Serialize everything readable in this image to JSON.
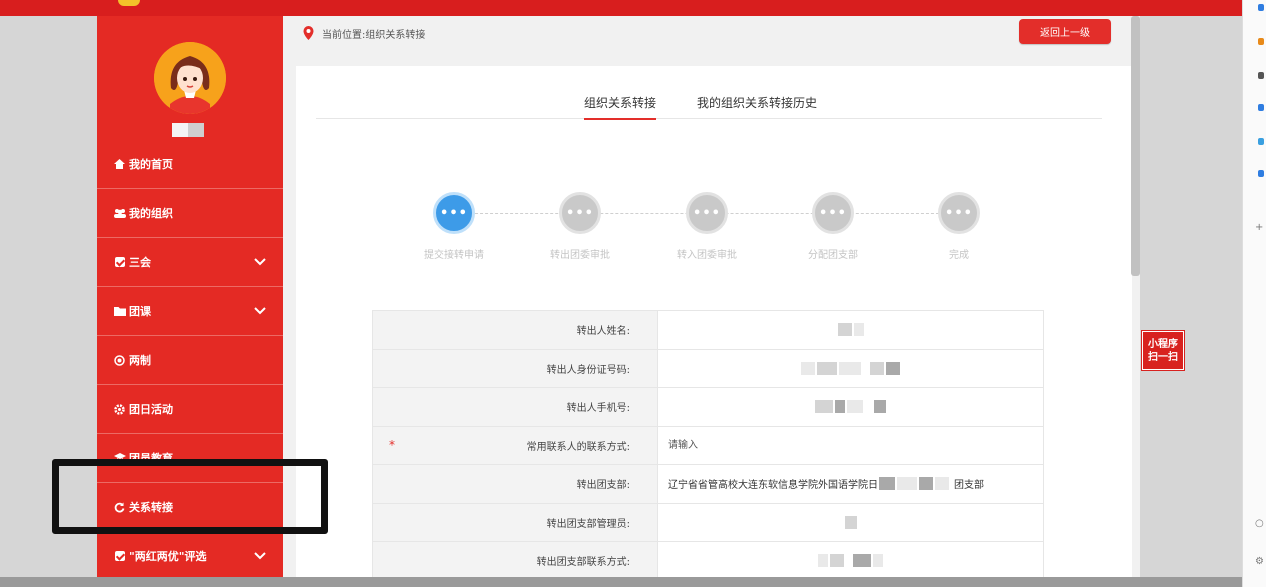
{
  "breadcrumb": {
    "text": "当前位置:组织关系转接"
  },
  "back_button": {
    "label": "返回上一级"
  },
  "tabs": [
    {
      "label": "组织关系转接",
      "active": true
    },
    {
      "label": "我的组织关系转接历史",
      "active": false
    }
  ],
  "sidebar": {
    "menu": [
      {
        "label": "我的首页",
        "icon": "home-icon",
        "has_submenu": false
      },
      {
        "label": "我的组织",
        "icon": "users-icon",
        "has_submenu": false
      },
      {
        "label": "三会",
        "icon": "checkbox-icon",
        "has_submenu": true
      },
      {
        "label": "团课",
        "icon": "folder-icon",
        "has_submenu": true
      },
      {
        "label": "两制",
        "icon": "circle-target-icon",
        "has_submenu": false
      },
      {
        "label": "团日活动",
        "icon": "gear-icon",
        "has_submenu": false
      },
      {
        "label": "团员教育",
        "icon": "graduation-cap-icon",
        "has_submenu": false
      },
      {
        "label": "关系转接",
        "icon": "refresh-icon",
        "has_submenu": false
      },
      {
        "label": "\"两红两优\"评选",
        "icon": "checkbox-icon",
        "has_submenu": true
      }
    ]
  },
  "steps": [
    {
      "label": "提交接转申请",
      "active": true,
      "symbol": "•••"
    },
    {
      "label": "转出团委审批",
      "active": false,
      "symbol": "•••"
    },
    {
      "label": "转入团委审批",
      "active": false,
      "symbol": "•••"
    },
    {
      "label": "分配团支部",
      "active": false,
      "symbol": "•••"
    },
    {
      "label": "完成",
      "active": false,
      "symbol": "•••"
    }
  ],
  "form": {
    "name_label": "转出人姓名:",
    "id_label": "转出人身份证号码:",
    "phone_label": "转出人手机号:",
    "contact_label": "常用联系人的联系方式:",
    "contact_placeholder": "请输入",
    "branch_label": "转出团支部:",
    "branch_value_prefix": "辽宁省省管高校大连东软信息学院外国语学院日",
    "branch_value_suffix": "团支部",
    "manager_label": "转出团支部管理员:",
    "branch_contact_label": "转出团支部联系方式:",
    "required_mark": "*"
  },
  "qr_badge": {
    "line1": "小程序",
    "line2": "扫一扫"
  },
  "colors": {
    "primary_red": "#e42a24",
    "active_step": "#3d9be8",
    "inactive_step": "#c9c9c9"
  }
}
